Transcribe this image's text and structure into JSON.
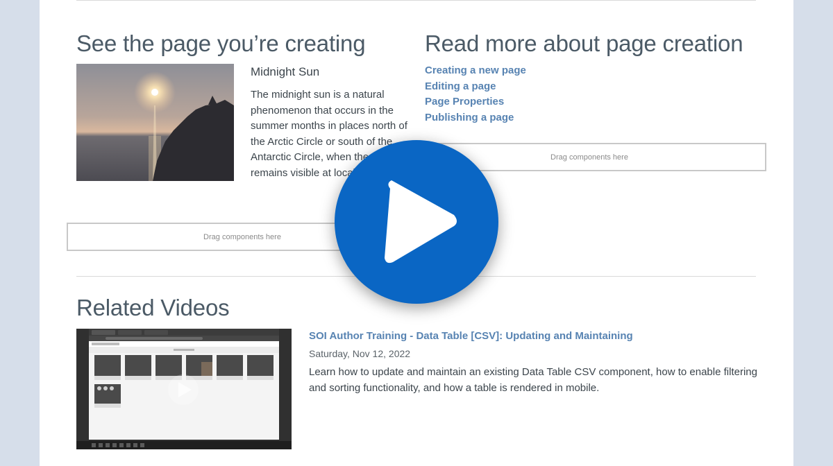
{
  "section_left": {
    "heading": "See the page you’re creating",
    "card": {
      "title": "Midnight Sun",
      "description": "The midnight sun is a natural phenomenon that occurs in the summer months in places north of the Arctic Circle or south of the Antarctic Circle, when the Sun remains visible at local midnight."
    },
    "dropzone_label": "Drag components here"
  },
  "section_right": {
    "heading": "Read more about page creation",
    "links": [
      "Creating a new page",
      "Editing a page",
      "Page Properties",
      "Publishing a page"
    ],
    "dropzone_label": "Drag components here"
  },
  "related": {
    "heading": "Related Videos",
    "video": {
      "title": "SOI Author Training - Data Table [CSV]: Updating and Maintaining",
      "date": "Saturday, Nov 12, 2022",
      "description": "Learn how to update and maintain an existing Data Table CSV component, how to enable filtering and sorting functionality, and how a table is rendered in mobile."
    }
  },
  "overlay": {
    "icon": "play-icon",
    "color": "#0a66c4"
  },
  "colors": {
    "link": "#5783b2",
    "heading": "#4b5a66",
    "text": "#3b444b",
    "background": "#d6deea"
  }
}
